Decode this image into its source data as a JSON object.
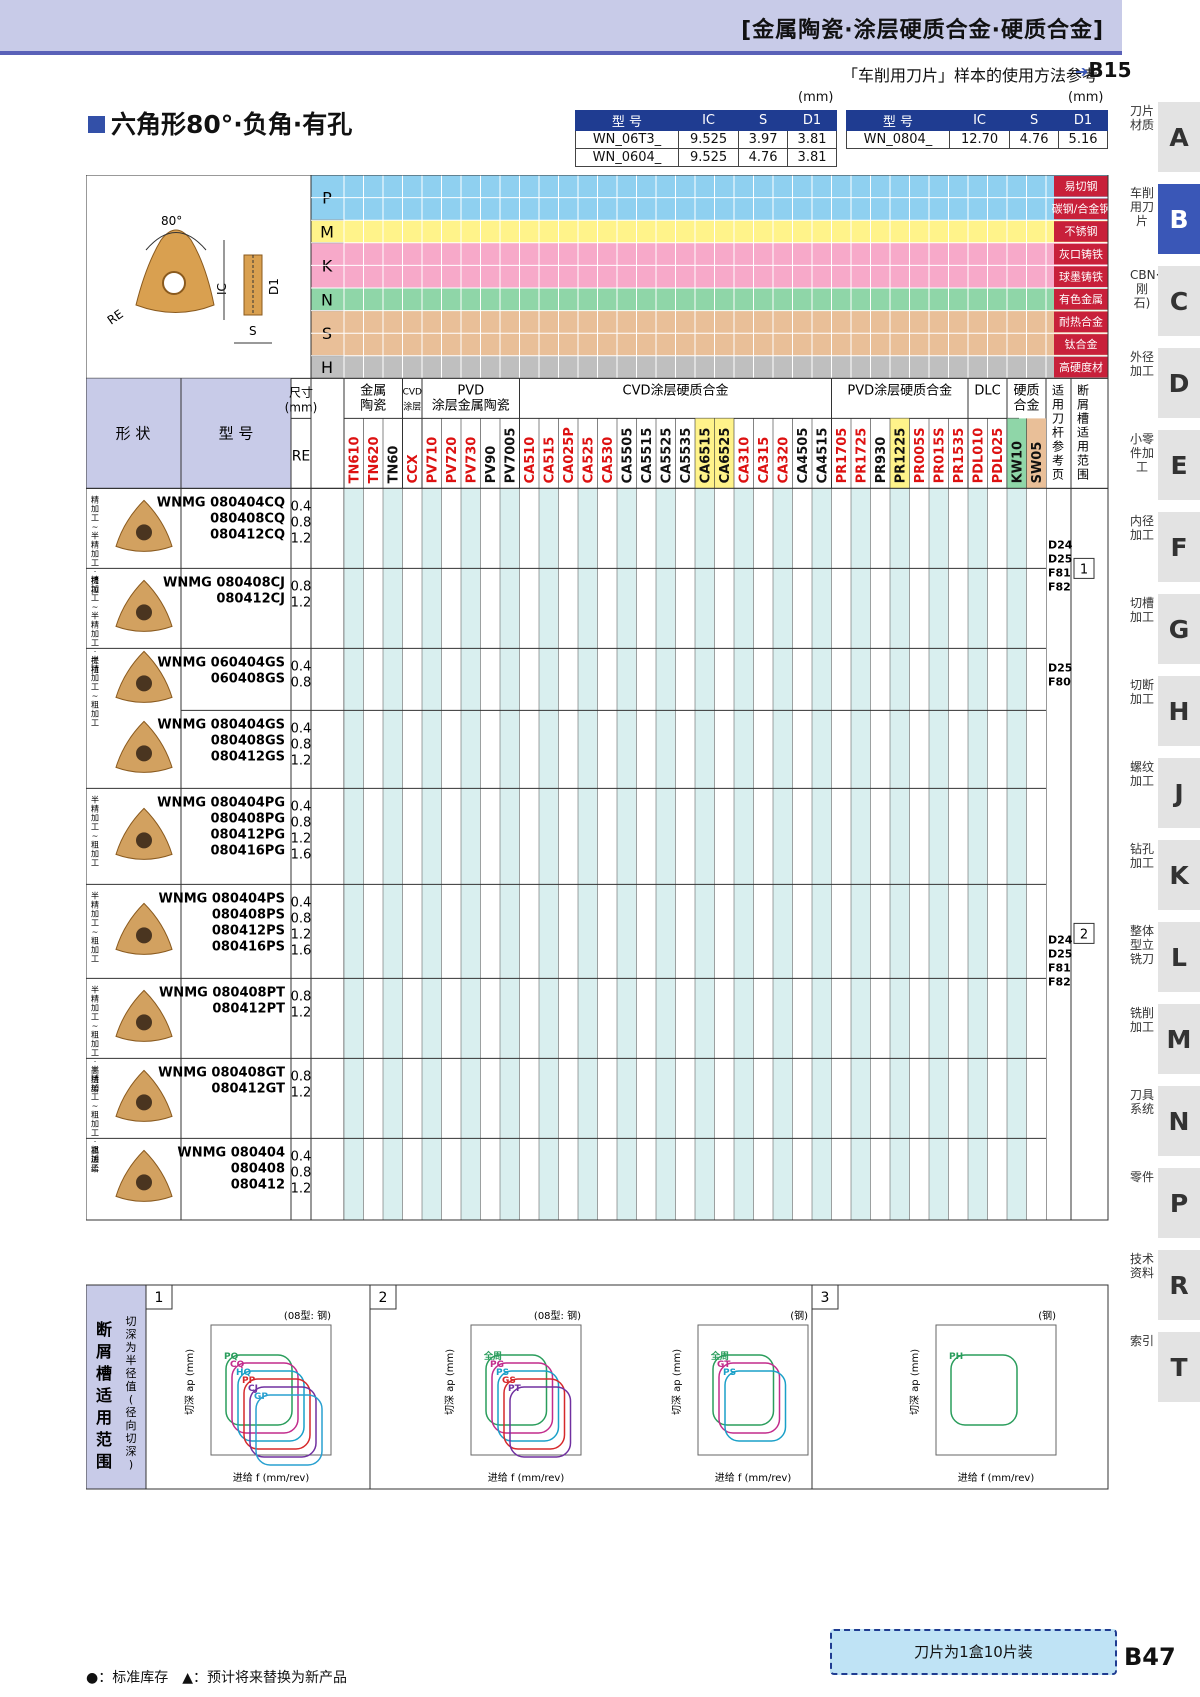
{
  "header": {
    "title": "[金属陶瓷·涂层硬质合金·硬质合金]",
    "ref_text": "「车削用刀片」样本的使用方法参考",
    "ref_page": "B15"
  },
  "title": "六角形80°·负角·有孔",
  "spec_unit": "(mm)",
  "spec_headers": [
    "型 号",
    "IC",
    "S",
    "D1"
  ],
  "spec1": [
    [
      "WN_06T3_",
      "9.525",
      "3.97",
      "3.81"
    ],
    [
      "WN_0604_",
      "9.525",
      "4.76",
      "3.81"
    ]
  ],
  "spec2": [
    [
      "WN_0804_",
      "12.70",
      "4.76",
      "5.16"
    ]
  ],
  "diagram": {
    "angle": "80°",
    "re": "RE",
    "ic": "IC",
    "s": "S",
    "d1": "D1"
  },
  "materials": [
    {
      "code": "P",
      "labels": [
        "易切钢",
        "碳钢/合金钢"
      ],
      "color": "#8fd0f0"
    },
    {
      "code": "M",
      "labels": [
        "不锈钢"
      ],
      "color": "#fff38a"
    },
    {
      "code": "K",
      "labels": [
        "灰口铸铁",
        "球墨铸铁"
      ],
      "color": "#f7a9c9"
    },
    {
      "code": "N",
      "labels": [
        "有色金属"
      ],
      "color": "#8fd6a8"
    },
    {
      "code": "S",
      "labels": [
        "耐热合金",
        "钛合金"
      ],
      "color": "#e9bf98"
    },
    {
      "code": "H",
      "labels": [
        "高硬度材"
      ],
      "color": "#bfbfbf"
    }
  ],
  "table_head": {
    "shape": "形 状",
    "model": "型 号",
    "size": "尺寸\n(mm)",
    "re": "RE",
    "groups": [
      "金属\n陶瓷",
      "CVD\n涂层",
      "PVD\n涂层金属陶瓷",
      "CVD涂层硬质合金",
      "PVD涂层硬质合金",
      "DLC",
      "硬质\n合金"
    ],
    "ref_pages": "适用刀杆参考页",
    "chip_range": "断屑槽适用范围"
  },
  "grades": [
    {
      "n": "TN610",
      "c": "#d11"
    },
    {
      "n": "TN620",
      "c": "#d11"
    },
    {
      "n": "TN60",
      "c": "#111"
    },
    {
      "n": "CCX",
      "c": "#d11"
    },
    {
      "n": "PV710",
      "c": "#d11"
    },
    {
      "n": "PV720",
      "c": "#d11"
    },
    {
      "n": "PV730",
      "c": "#d11"
    },
    {
      "n": "PV90",
      "c": "#111"
    },
    {
      "n": "PV7005",
      "c": "#111"
    },
    {
      "n": "CA510",
      "c": "#d11"
    },
    {
      "n": "CA515",
      "c": "#d11"
    },
    {
      "n": "CA025P",
      "c": "#d11"
    },
    {
      "n": "CA525",
      "c": "#d11"
    },
    {
      "n": "CA530",
      "c": "#d11"
    },
    {
      "n": "CA5505",
      "c": "#111"
    },
    {
      "n": "CA5515",
      "c": "#111"
    },
    {
      "n": "CA5525",
      "c": "#111"
    },
    {
      "n": "CA5535",
      "c": "#111"
    },
    {
      "n": "CA6515",
      "c": "#111",
      "bg": "#fff38a"
    },
    {
      "n": "CA6525",
      "c": "#111",
      "bg": "#fff38a"
    },
    {
      "n": "CA310",
      "c": "#d11"
    },
    {
      "n": "CA315",
      "c": "#d11"
    },
    {
      "n": "CA320",
      "c": "#d11"
    },
    {
      "n": "CA4505",
      "c": "#111"
    },
    {
      "n": "CA4515",
      "c": "#111"
    },
    {
      "n": "PR1705",
      "c": "#d11"
    },
    {
      "n": "PR1725",
      "c": "#d11"
    },
    {
      "n": "PR930",
      "c": "#111"
    },
    {
      "n": "PR1225",
      "c": "#111",
      "bg": "#fff38a"
    },
    {
      "n": "PR005S",
      "c": "#d11"
    },
    {
      "n": "PR015S",
      "c": "#d11"
    },
    {
      "n": "PR1535",
      "c": "#d11"
    },
    {
      "n": "PDL010",
      "c": "#d11"
    },
    {
      "n": "PDL025",
      "c": "#d11"
    },
    {
      "n": "KW10",
      "c": "#111",
      "bg": "#8fd6a8"
    },
    {
      "n": "SW05",
      "c": "#111",
      "bg": "#e9bf98"
    }
  ],
  "rows": [
    {
      "app": "精加工~半精加工·提拉",
      "models": [
        "WNMG 080404CQ",
        "080408CQ",
        "080412CQ"
      ],
      "re": [
        "0.4",
        "0.8",
        "1.2"
      ]
    },
    {
      "app": "精加工~半精加工·提拉",
      "models": [
        "WNMG 080408CJ",
        "080412CJ"
      ],
      "re": [
        "0.8",
        "1.2"
      ]
    },
    {
      "app": "半精加工~粗加工",
      "models": [
        "WNMG 060404GS",
        "060408GS"
      ],
      "re": [
        "0.4",
        "0.8"
      ]
    },
    {
      "app": "",
      "models": [
        "WNMG 080404GS",
        "080408GS",
        "080412GS"
      ],
      "re": [
        "0.4",
        "0.8",
        "1.2"
      ]
    },
    {
      "app": "半精加工~粗加工",
      "models": [
        "WNMG 080404PG",
        "080408PG",
        "080412PG",
        "080416PG"
      ],
      "re": [
        "0.4",
        "0.8",
        "1.2",
        "1.6"
      ]
    },
    {
      "app": "半精加工~粗加工",
      "models": [
        "WNMG 080404PS",
        "080408PS",
        "080412PS",
        "080416PS"
      ],
      "re": [
        "0.4",
        "0.8",
        "1.2",
        "1.6"
      ]
    },
    {
      "app": "半精加工~粗加工·高进给",
      "models": [
        "WNMG 080408PT",
        "080412PT"
      ],
      "re": [
        "0.8",
        "1.2"
      ]
    },
    {
      "app": "半精加工~粗加工·高进给",
      "models": [
        "WNMG 080408GT",
        "080412GT"
      ],
      "re": [
        "0.8",
        "1.2"
      ]
    },
    {
      "app": "粗加工",
      "models": [
        "WNMG 080404",
        "080408",
        "080412"
      ],
      "re": [
        "0.4",
        "0.8",
        "1.2"
      ]
    }
  ],
  "ref_pages_a": [
    "D24",
    "D25",
    "F81",
    "F82"
  ],
  "ref_pages_b": [
    "D25",
    "F80"
  ],
  "ref_pages_c": [
    "D24",
    "D25",
    "F81",
    "F82"
  ],
  "chip_no": [
    "1",
    "2"
  ],
  "chart_title": "断屑槽适用范围",
  "chart_side": "切深为半径值(径向切深)",
  "charts": [
    {
      "no": "1",
      "note": "(08型: 钢)",
      "xlabel": "进给 f (mm/rev)",
      "ylabel": "切深 ap (mm)",
      "labels": [
        "PQ",
        "CQ",
        "HQ",
        "PP",
        "CJ",
        "GP"
      ]
    },
    {
      "no": "2",
      "note": "(08型: 钢)",
      "xlabel": "进给 f (mm/rev)",
      "ylabel": "切深 ap (mm)",
      "labels": [
        "全周",
        "PG",
        "PS",
        "GS",
        "PT"
      ]
    },
    {
      "no": "",
      "note": "(钢)",
      "xlabel": "进给 f (mm/rev)",
      "ylabel": "切深 ap (mm)",
      "labels": [
        "全周",
        "GT",
        "PS"
      ]
    },
    {
      "no": "3",
      "note": "(钢)",
      "xlabel": "进给 f (mm/rev)",
      "ylabel": "切深 ap (mm)",
      "labels": [
        "PH"
      ]
    }
  ],
  "footer": {
    "legend": "●：标准库存　▲：预计将来替换为新产品",
    "box": "刀片为1盒10片装",
    "page": "B47"
  },
  "sidebar": [
    {
      "t": "刀片材质",
      "l": "A"
    },
    {
      "t": "车削用刀片",
      "l": "B",
      "active": true
    },
    {
      "t": "CBN·PCD(金刚石)",
      "l": "C"
    },
    {
      "t": "外径加工",
      "l": "D"
    },
    {
      "t": "小零件加工",
      "l": "E"
    },
    {
      "t": "内径加工",
      "l": "F"
    },
    {
      "t": "切槽加工",
      "l": "G"
    },
    {
      "t": "切断加工",
      "l": "H"
    },
    {
      "t": "螺纹加工",
      "l": "J"
    },
    {
      "t": "钻孔加工",
      "l": "K"
    },
    {
      "t": "整体型立铣刀",
      "l": "L"
    },
    {
      "t": "铣削加工",
      "l": "M"
    },
    {
      "t": "刀具系统",
      "l": "N"
    },
    {
      "t": "零件",
      "l": "P"
    },
    {
      "t": "技术资料",
      "l": "R"
    },
    {
      "t": "索引",
      "l": "T"
    }
  ]
}
